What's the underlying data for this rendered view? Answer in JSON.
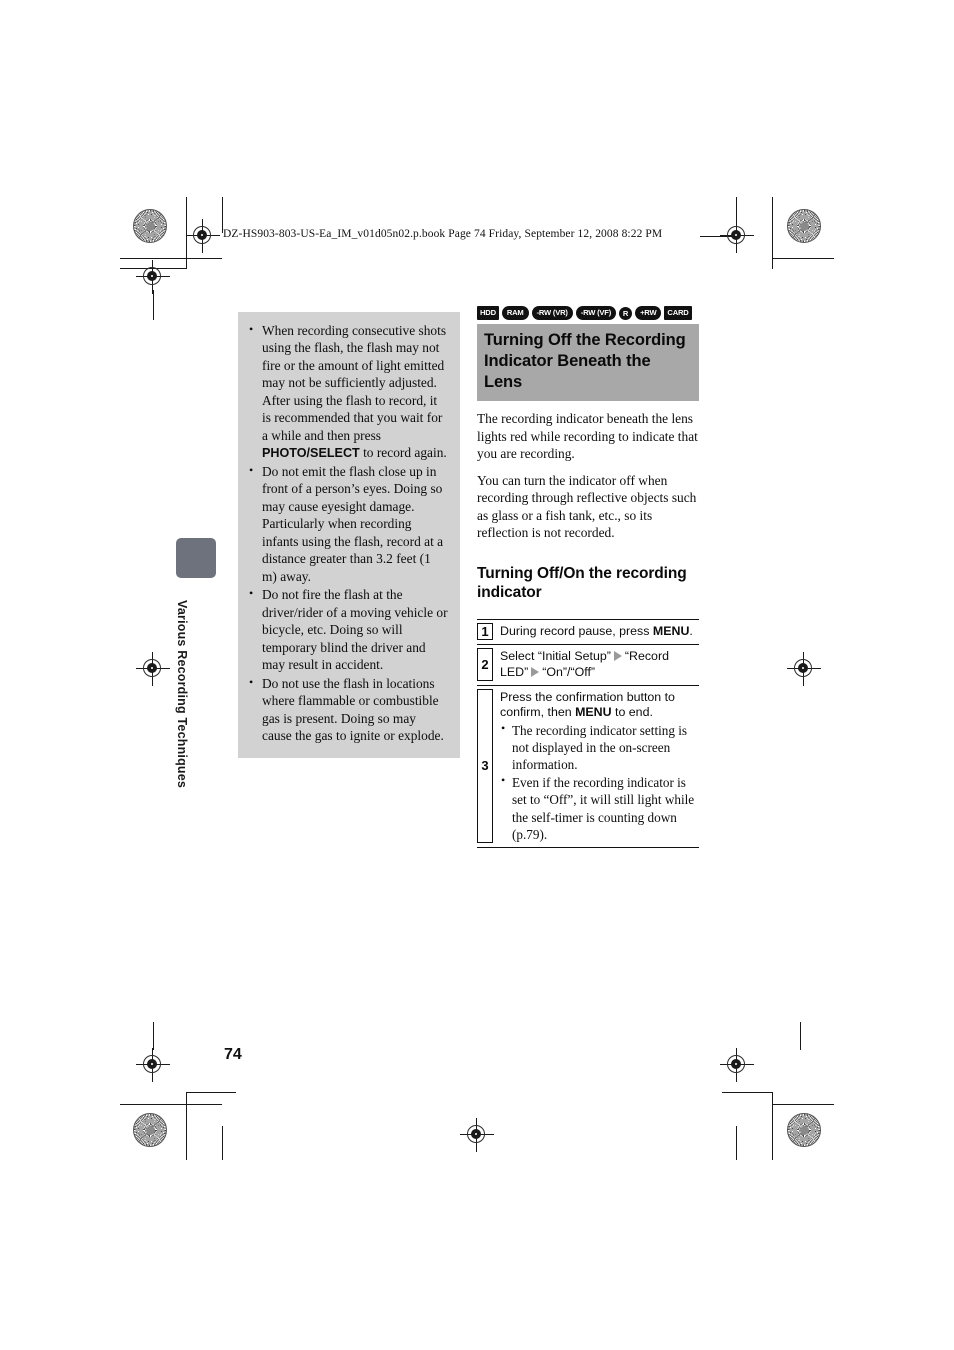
{
  "document": {
    "file_header": "DZ-HS903-803-US-Ea_IM_v01d05n02.p.book  Page 74  Friday, September 12, 2008  8:22 PM",
    "page_number": "74",
    "side_tab_label": "Various Recording Techniques"
  },
  "left_column": {
    "notes": [
      "When recording consecutive shots using the flash, the flash may not fire or the amount of light emitted may not be sufficiently adjusted. After using the flash to record, it is recommended that you wait for a while and then press ",
      "Do not emit the flash close up in front of a person’s eyes. Doing so may cause eyesight damage. Particularly when recording infants using the flash, record at a distance greater than 3.2 feet (1 m) away.",
      "Do not fire the flash at the driver/rider of a moving vehicle or bicycle, etc. Doing so will temporary blind the driver and may result in accident.",
      "Do not use the flash in locations where flammable or combustible gas is present. Doing so may cause the gas to ignite or explode."
    ],
    "note1_bold": "PHOTO/SELECT",
    "note1_tail": " to record again."
  },
  "right_column": {
    "media_badges": [
      {
        "label": "HDD",
        "shape": "sq"
      },
      {
        "label": "RAM",
        "shape": "pill"
      },
      {
        "label": "-RW (VR)",
        "shape": "pill"
      },
      {
        "label": "-RW (VF)",
        "shape": "pill"
      },
      {
        "label": "R",
        "shape": "circ"
      },
      {
        "label": "+RW",
        "shape": "pill"
      },
      {
        "label": "CARD",
        "shape": "sq"
      }
    ],
    "section_title": "Turning Off the Recording Indicator Beneath the Lens",
    "paragraph_1": "The recording indicator beneath the lens lights red while recording to indicate that you are recording.",
    "paragraph_2": "You can turn the indicator off when recording through reflective objects such as glass or a fish tank, etc., so its reflection is not recorded.",
    "sub_heading": "Turning Off/On the recording indicator",
    "steps": {
      "step1": {
        "number": "1",
        "text_before": "During record pause, press ",
        "bold": "MENU",
        "text_after": "."
      },
      "step2": {
        "number": "2",
        "part1": "Select “Initial Setup”",
        "part2": "“Record LED”",
        "part3": "“On”/“Off”"
      },
      "step3": {
        "number": "3",
        "text_before": "Press the confirmation button to confirm, then ",
        "bold": "MENU",
        "text_after": " to end.",
        "bullets": [
          "The recording indicator setting is not displayed in the on-screen information.",
          "Even if the recording indicator is set to “Off”, it will still light while the self-timer is counting down (p.79)."
        ]
      }
    }
  },
  "colors": {
    "note_box_bg": "#d2d2d2",
    "section_head_bg": "#a8a8a8",
    "side_tab_bg": "#6e727c",
    "arrow": "#9a9a9a"
  }
}
